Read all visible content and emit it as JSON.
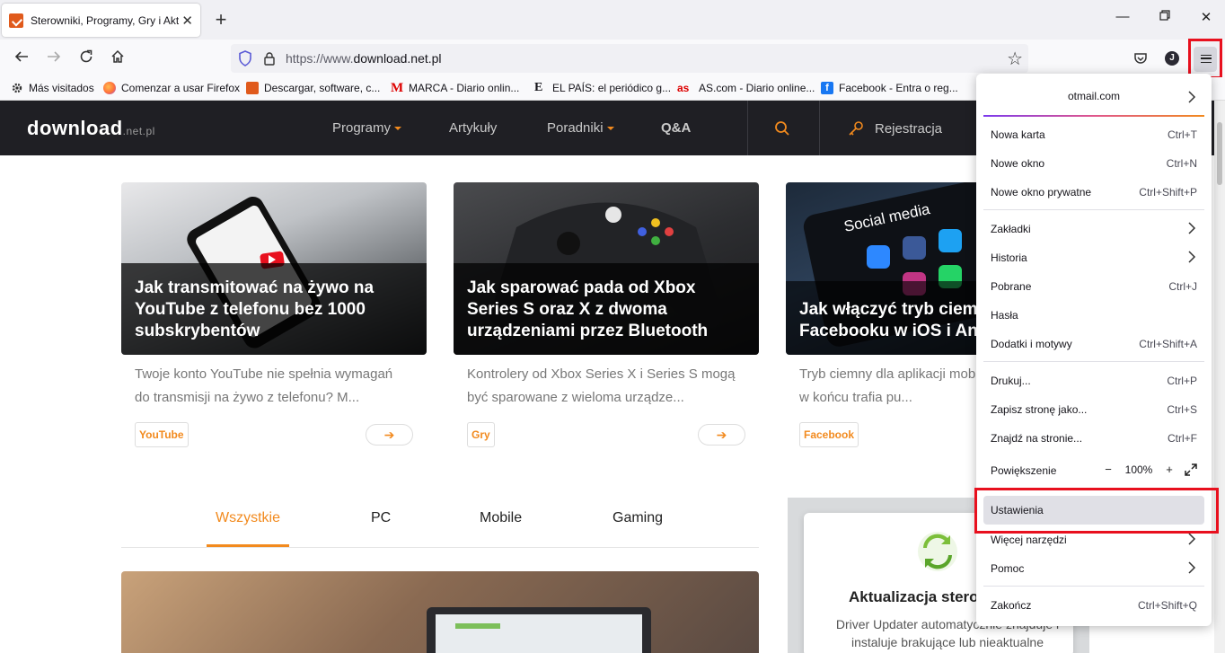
{
  "browser": {
    "tab_title": "Sterowniki, Programy, Gry i Aktu",
    "url_prefix": "https://www.",
    "url_domain": "download.net.pl",
    "account_initial": "J"
  },
  "bookmarks": [
    {
      "label": "Más visitados",
      "icon": "gear-icon"
    },
    {
      "label": "Comenzar a usar Firefox",
      "icon": "firefox-icon"
    },
    {
      "label": "Descargar, software, c...",
      "icon": "download-icon"
    },
    {
      "label": "MARCA - Diario onlin...",
      "icon": "marca-icon"
    },
    {
      "label": "EL PAÍS: el periódico g...",
      "icon": "elpais-icon"
    },
    {
      "label": "AS.com - Diario online...",
      "icon": "as-icon"
    },
    {
      "label": "Facebook - Entra o reg...",
      "icon": "facebook-icon"
    }
  ],
  "site": {
    "logo": "download",
    "logo_suffix": ".net.pl",
    "nav": [
      "Programy",
      "Artykuły",
      "Poradniki",
      "Q&A"
    ],
    "register": "Rejestracja",
    "accent": "#f28a1e"
  },
  "cards": [
    {
      "title": "Jak transmitować na żywo na YouTube z telefonu bez 1000 subskrybentów",
      "desc": "Twoje konto YouTube nie spełnia wymagań do transmisji na żywo z telefonu? M...",
      "tag": "YouTube"
    },
    {
      "title": "Jak sparować pada od Xbox Series S oraz X z dwoma urządzeniami przez Bluetooth",
      "desc": "Kontrolery od Xbox Series X i Series S mogą być sparowane z wieloma urządze...",
      "tag": "Gry"
    },
    {
      "title": "Jak włączyć tryb ciemny na Facebooku w iOS i Android",
      "desc": "Tryb ciemny dla aplikacji mobilnej Facebooka w końcu trafia pu...",
      "tag": "Facebook",
      "image_text": "Social media"
    }
  ],
  "categories": [
    "Wszystkie",
    "PC",
    "Mobile",
    "Gaming"
  ],
  "promo": {
    "title": "Aktualizacja sterowników",
    "text": "Driver Updater automatycznie znajduje i instaluje brakujące lub nieaktualne"
  },
  "menu": {
    "account_email": "otmail.com",
    "items": [
      {
        "label": "Nowa karta",
        "shortcut": "Ctrl+T"
      },
      {
        "label": "Nowe okno",
        "shortcut": "Ctrl+N"
      },
      {
        "label": "Nowe okno prywatne",
        "shortcut": "Ctrl+Shift+P"
      },
      {
        "label": "Zakładki",
        "shortcut": ""
      },
      {
        "label": "Historia",
        "shortcut": ""
      },
      {
        "label": "Pobrane",
        "shortcut": "Ctrl+J"
      },
      {
        "label": "Hasła",
        "shortcut": ""
      },
      {
        "label": "Dodatki i motywy",
        "shortcut": "Ctrl+Shift+A"
      },
      {
        "label": "Drukuj...",
        "shortcut": "Ctrl+P"
      },
      {
        "label": "Zapisz stronę jako...",
        "shortcut": "Ctrl+S"
      },
      {
        "label": "Znajdź na stronie...",
        "shortcut": "Ctrl+F"
      },
      {
        "label": "Powiększenie",
        "shortcut": ""
      },
      {
        "label": "Ustawienia",
        "shortcut": ""
      },
      {
        "label": "Więcej narzędzi",
        "shortcut": ""
      },
      {
        "label": "Pomoc",
        "shortcut": ""
      },
      {
        "label": "Zakończ",
        "shortcut": "Ctrl+Shift+Q"
      }
    ],
    "zoom_value": "100%",
    "zoom_minus": "−",
    "zoom_plus": "+"
  }
}
